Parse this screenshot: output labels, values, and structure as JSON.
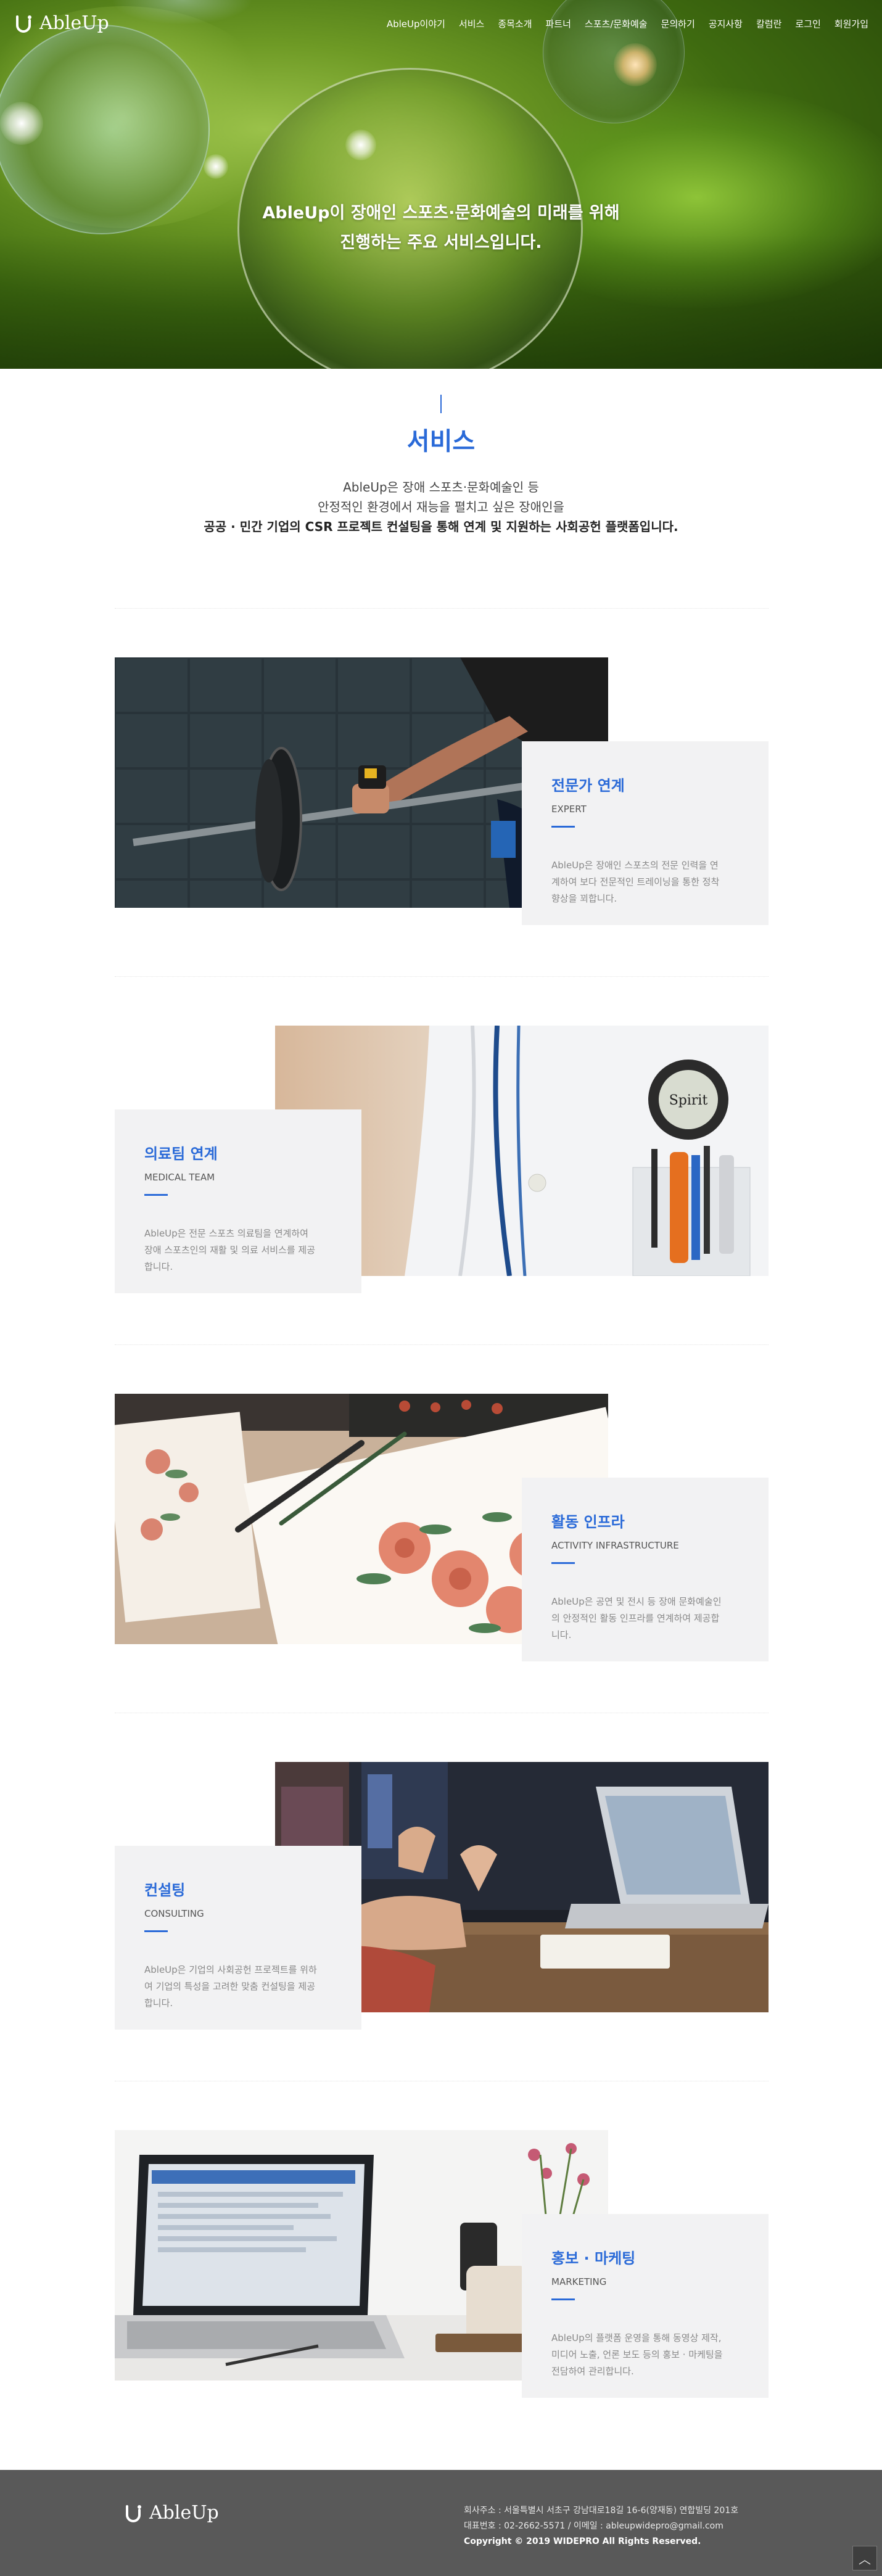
{
  "brand": {
    "name": "AbleUp"
  },
  "nav": {
    "items": [
      {
        "label": "AbleUp이야기"
      },
      {
        "label": "서비스"
      },
      {
        "label": "종목소개"
      },
      {
        "label": "파트너"
      },
      {
        "label": "스포츠/문화예술"
      },
      {
        "label": "문의하기"
      },
      {
        "label": "공지사항"
      },
      {
        "label": "칼럼란"
      },
      {
        "label": "로그인"
      },
      {
        "label": "회원가입"
      }
    ]
  },
  "hero": {
    "line1": "AbleUp이 장애인 스포츠·문화예술의 미래를 위해",
    "line2": "진행하는 주요 서비스입니다."
  },
  "intro": {
    "title": "서비스",
    "p1": "AbleUp은 장애 스포츠·문화예술인 등",
    "p2": "안정적인 환경에서 재능을 펼치고 싶은 장애인을",
    "p3": "공공 · 민간 기업의 CSR 프로젝트 컨설팅을 통해 연계 및 지원하는 사회공헌 플랫폼입니다."
  },
  "services": [
    {
      "title": "전문가 연계",
      "en": "EXPERT",
      "desc": [
        "AbleUp은 장애인 스포츠의 전문 인력을 연",
        "계하여 보다 전문적인 트레이닝을 통한 정착",
        "향상을 꾀합니다."
      ],
      "photo": "barbell-photo"
    },
    {
      "title": "의료팀 연계",
      "en": "MEDICAL TEAM",
      "desc": [
        "AbleUp은 전문 스포츠 의료팀을 연계하여",
        "장애 스포츠인의 재활 및 의료 서비스를 제공",
        "합니다."
      ],
      "photo": "stethoscope-photo"
    },
    {
      "title": "활동 인프라",
      "en": "ACTIVITY INFRASTRUCTURE",
      "desc": [
        "AbleUp은 공연 및 전시 등 장애 문화예술인",
        "의 안정적인 활동 인프라를 연계하여 제공합",
        "니다."
      ],
      "photo": "watercolor-photo"
    },
    {
      "title": "컨설팅",
      "en": "CONSULTING",
      "desc": [
        "AbleUp은 기업의 사회공헌 프로젝트를 위하",
        "여 기업의 특성을 고려한 맞춤 컨설팅을 제공",
        "합니다."
      ],
      "photo": "meeting-photo"
    },
    {
      "title": "홍보 · 마케팅",
      "en": "MARKETING",
      "desc": [
        "AbleUp의 플랫폼 운영을 통해 동영상 제작,",
        "미디어 노출, 언론 보도 등의 홍보 · 마케팅을",
        "전담하여 관리합니다."
      ],
      "photo": "laptop-photo"
    }
  ],
  "footer": {
    "address": "회사주소 : 서울특별시 서초구 강남대로18길 16-6(양재동) 연합빌딩 201호",
    "contact": "대표번호 : 02-2662-5571 / 이메일 : ableupwidepro@gmail.com",
    "copyright": "Copyright © 2019 WIDEPRO All Rights Reserved.",
    "top_button": "︿"
  },
  "colors": {
    "accent": "#2a6ad8",
    "card_bg": "#f2f2f3",
    "footer_bg": "#595959"
  }
}
